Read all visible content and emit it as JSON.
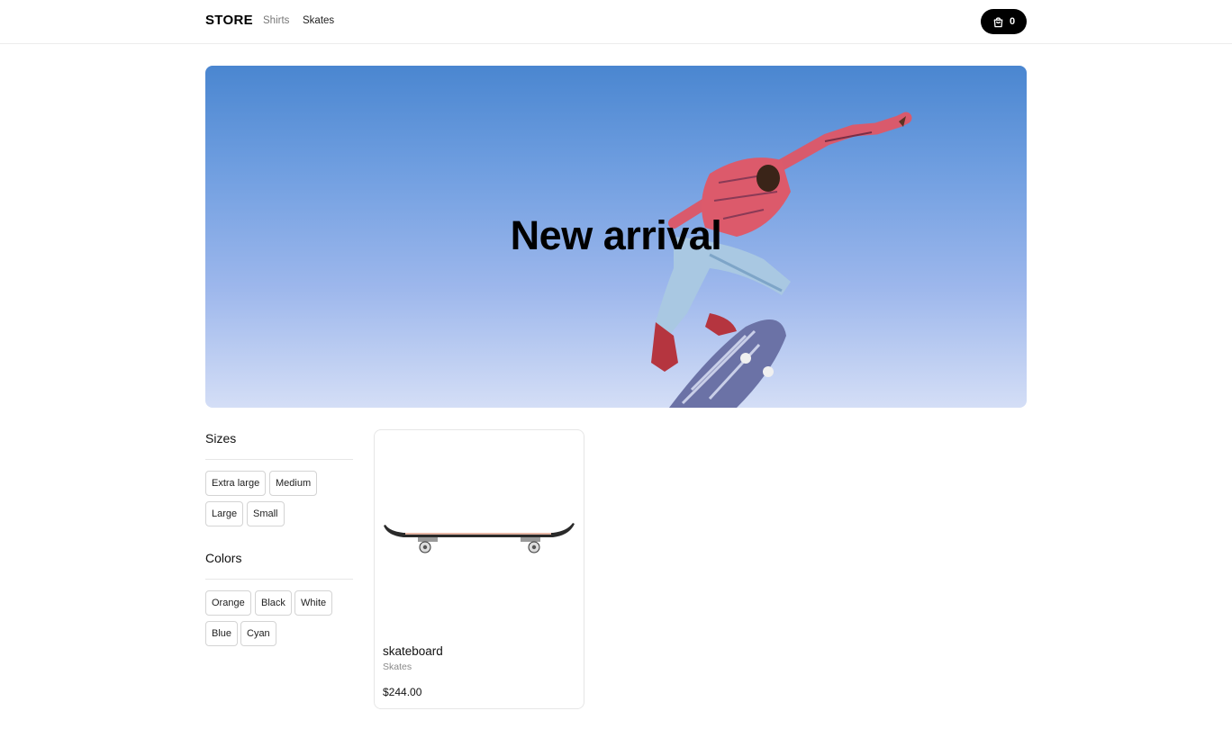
{
  "nav": {
    "logo": "STORE",
    "links": [
      {
        "label": "Shirts"
      },
      {
        "label": "Skates"
      }
    ],
    "cart": {
      "count": "0",
      "icon": "shopping-bag-icon"
    }
  },
  "hero": {
    "title": "New arrival"
  },
  "filters": {
    "sizes": {
      "heading": "Sizes",
      "options": [
        "Extra large",
        "Medium",
        "Large",
        "Small"
      ]
    },
    "colors": {
      "heading": "Colors",
      "options": [
        "Orange",
        "Black",
        "White",
        "Blue",
        "Cyan"
      ]
    }
  },
  "products": [
    {
      "name": "skateboard",
      "category": "Skates",
      "price": "$244.00"
    }
  ],
  "theme": {
    "accent": "#000000",
    "hero_sky_top": "#4a86d0",
    "hero_sky_bottom": "#d4def6"
  }
}
